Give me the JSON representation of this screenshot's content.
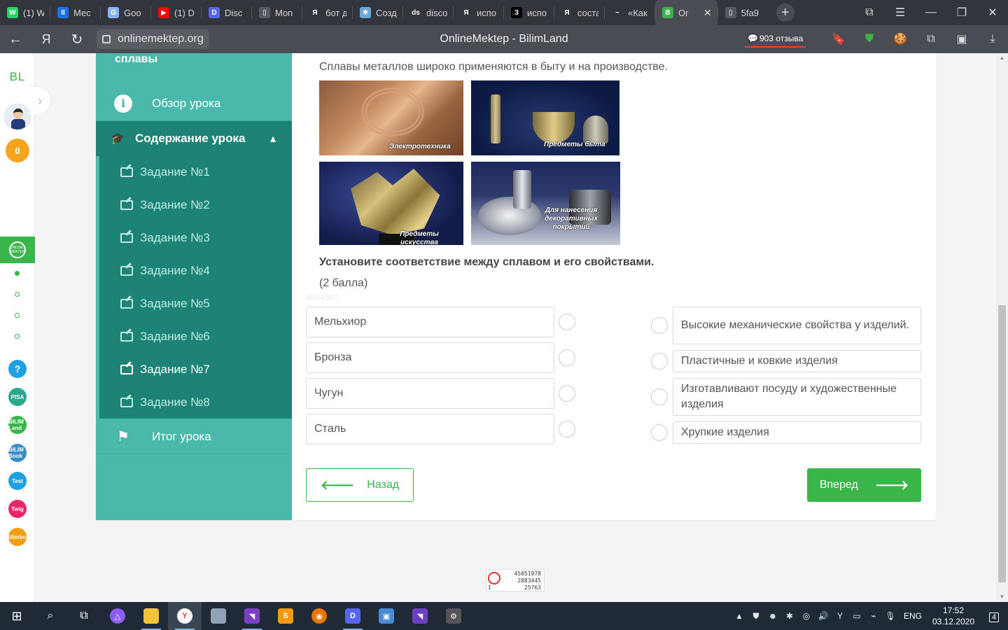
{
  "browser": {
    "tabs": [
      {
        "label": "(1) W",
        "icon": "whatsapp-icon",
        "color": "#25d366",
        "glyph": "W"
      },
      {
        "label": "Мес",
        "icon": "messenger-icon",
        "color": "#1a73e8",
        "glyph": "II"
      },
      {
        "label": "Goo",
        "icon": "google-icon",
        "color": "#8ab4f8",
        "glyph": "G"
      },
      {
        "label": "(1) D",
        "icon": "youtube-icon",
        "color": "#ff0000",
        "glyph": "▶"
      },
      {
        "label": "Disc",
        "icon": "discord-icon",
        "color": "#5865f2",
        "glyph": "D"
      },
      {
        "label": "Mon",
        "icon": "document-icon",
        "color": "#555a63",
        "glyph": "▯"
      },
      {
        "label": "бот д",
        "icon": "yandex-icon",
        "color": "#33353c",
        "glyph": "Я"
      },
      {
        "label": "Созд",
        "icon": "generic-site-icon",
        "color": "#6aa7d8",
        "glyph": "✱"
      },
      {
        "label": "disco",
        "icon": "generic-site-icon",
        "color": "#33353c",
        "glyph": "ds"
      },
      {
        "label": "испо",
        "icon": "yandex-icon",
        "color": "#33353c",
        "glyph": "Я"
      },
      {
        "label": "испо",
        "icon": "znanija-icon",
        "color": "#000000",
        "glyph": "З"
      },
      {
        "label": "соста",
        "icon": "yandex-icon",
        "color": "#33353c",
        "glyph": "Я"
      },
      {
        "label": "«Как",
        "icon": "generic-site-icon",
        "color": "#33353c",
        "glyph": "~"
      },
      {
        "label": "Or",
        "icon": "onlinemektep-icon",
        "color": "#3ab54a",
        "glyph": "B",
        "active": true
      },
      {
        "label": "5fa9",
        "icon": "document-icon",
        "color": "#555a63",
        "glyph": "▯"
      }
    ],
    "url": "onlinemektep.org",
    "page_title": "OnlineMektep - BilimLand",
    "reviews": "903 отзыва",
    "yandex_glyph": "Я"
  },
  "rail": {
    "logo": "BL",
    "coins": "0",
    "active_icon": "ONLINE MEKTEP",
    "help": "?",
    "apps": [
      {
        "name": "pisa-app-icon",
        "glyph": "PISA",
        "color": "#2aa889"
      },
      {
        "name": "bilimland-app-icon",
        "glyph": "BILIM Land",
        "color": "#3ab54a"
      },
      {
        "name": "bilimbook-app-icon",
        "glyph": "BILIM Book",
        "color": "#3a8cc4"
      },
      {
        "name": "bilim-test-app-icon",
        "glyph": "Test",
        "color": "#1da1e0"
      },
      {
        "name": "twig-app-icon",
        "glyph": "Twig",
        "color": "#e6276b"
      },
      {
        "name": "bilimbox-app-icon",
        "glyph": "Bilimbox",
        "color": "#f39c12"
      }
    ]
  },
  "lesson": {
    "title_tail": "сплавы",
    "overview": "Обзор урока",
    "content": "Содержание урока",
    "tasks": [
      "Задание №1",
      "Задание №2",
      "Задание №3",
      "Задание №4",
      "Задание №5",
      "Задание №6",
      "Задание №7",
      "Задание №8"
    ],
    "current_task_index": 6,
    "summary": "Итог урока"
  },
  "main": {
    "intro": "Сплавы металлов широко применяются в быту и на производстве.",
    "photos": [
      {
        "caption": "Электротехника"
      },
      {
        "caption": "Предметы быта"
      },
      {
        "caption": "Предметы искусства"
      },
      {
        "caption": "Для нанесения декоративных покрытий"
      }
    ],
    "question": "Установите соответствие между сплавом и его свойствами.",
    "score": "(2 балла)",
    "ghost_id": "4694367",
    "left_items": [
      "Мельхиор",
      "Бронза",
      "Чугун",
      "Сталь"
    ],
    "right_items": [
      "Высокие механические свойства у изделий.",
      "Пластичные и ковкие изделия",
      "Изготавливают посуду и художественные изделия",
      "Хрупкие изделия"
    ],
    "back_label": "Назад",
    "next_label": "Вперед"
  },
  "counter": {
    "line1": "45051978",
    "line2": "2883445",
    "line3": "1",
    "line4": "25763"
  },
  "taskbar": {
    "lang": "ENG",
    "time": "17:52",
    "date": "03.12.2020",
    "notifications": "4"
  },
  "colors": {
    "accent_green": "#3ab54a",
    "nav_teal": "#4ab9ab",
    "nav_dark": "#1e8377"
  }
}
